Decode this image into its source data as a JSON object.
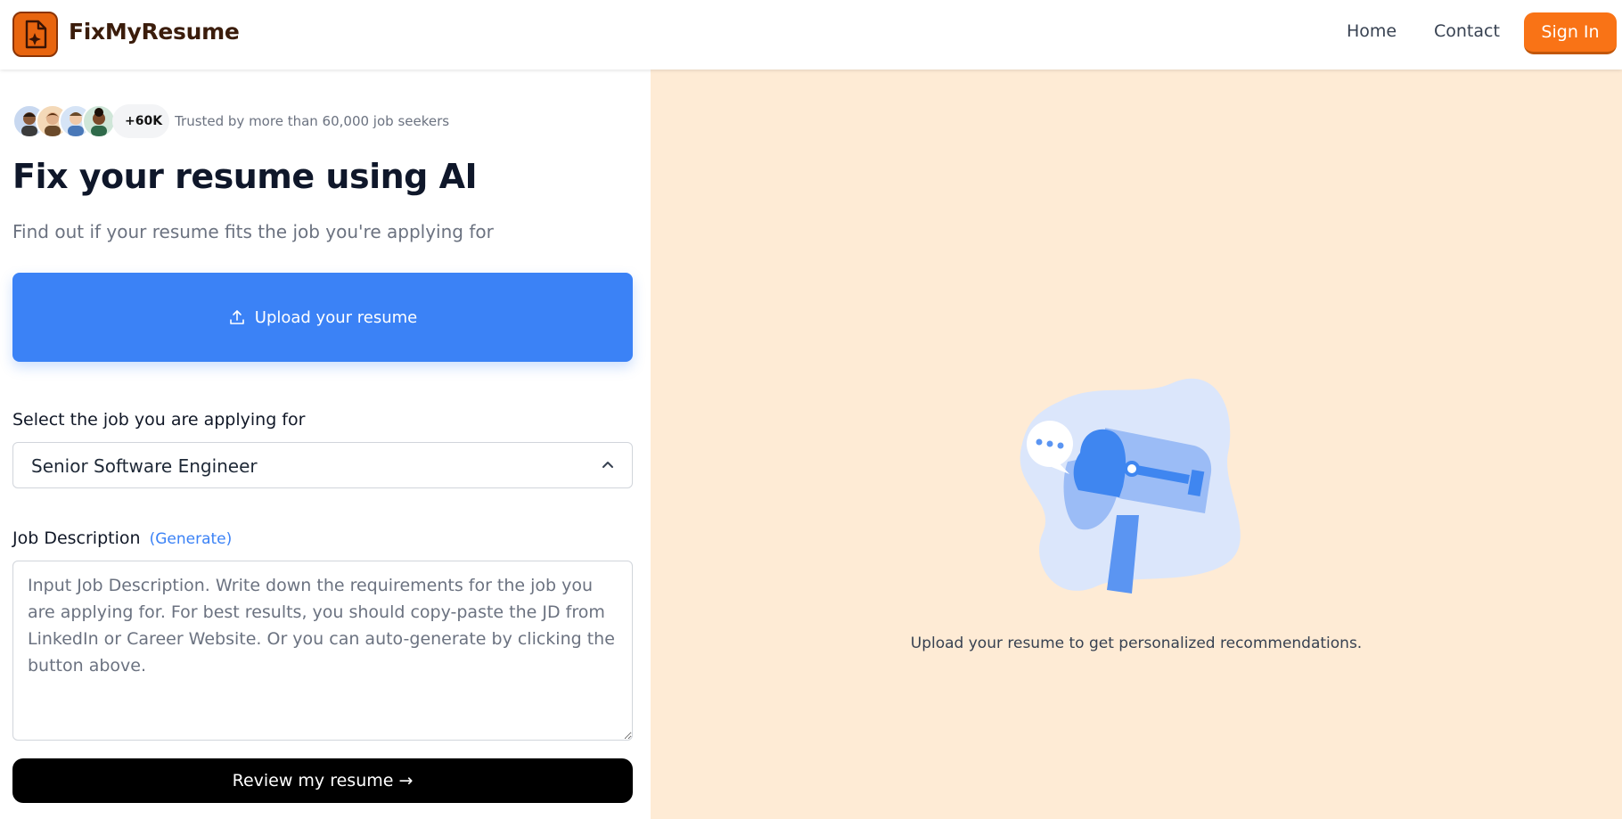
{
  "header": {
    "brand": "FixMyResume",
    "logo_icon": "document-sparkle-icon",
    "nav": [
      {
        "label": "Home"
      },
      {
        "label": "Contact"
      }
    ],
    "signin_label": "Sign In",
    "accent_color": "#f97316"
  },
  "trust": {
    "count": "+60K",
    "text": "Trusted by more than 60,000 job seekers"
  },
  "hero": {
    "title": "Fix your resume using AI",
    "subtitle": "Find out if your resume fits the job you're applying for"
  },
  "upload": {
    "label": "Upload your resume",
    "icon": "upload-icon",
    "color": "#3b82f6"
  },
  "job_select": {
    "label": "Select the job you are applying for",
    "value": "Senior Software Engineer",
    "icon": "chevron-up-icon"
  },
  "job_description": {
    "label": "Job Description",
    "generate_label": "(Generate)",
    "placeholder": "Input Job Description. Write down the requirements for the job you are applying for. For best results, you should copy-paste the JD from LinkedIn or Career Website. Or you can auto-generate by clicking the button above.",
    "value": ""
  },
  "review_button": {
    "label": "Review my resume →"
  },
  "right_panel": {
    "background": "#feebd5",
    "illustration": "megaphone-illustration",
    "caption": "Upload your resume to get personalized recommendations."
  }
}
